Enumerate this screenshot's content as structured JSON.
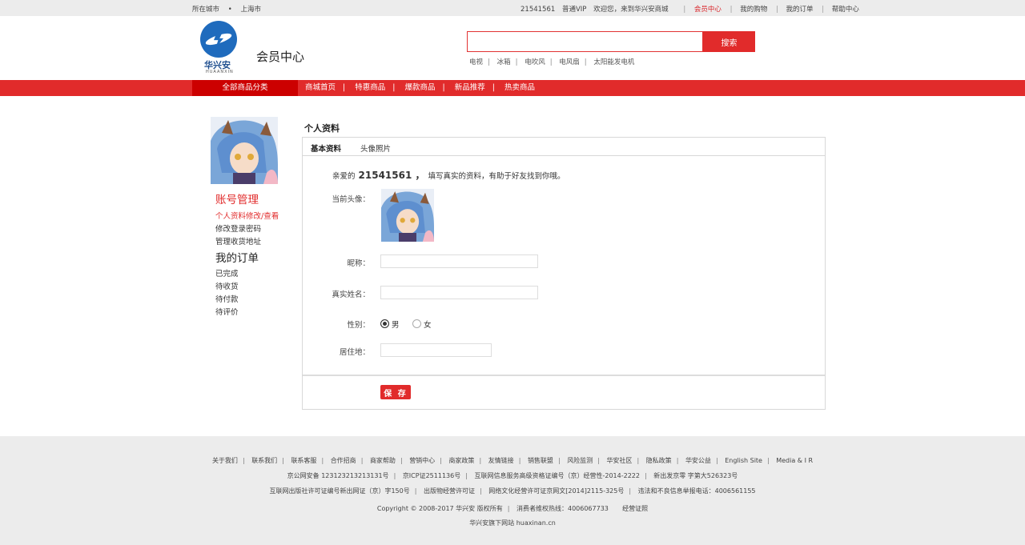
{
  "topbar": {
    "city_label": "所在城市",
    "dot": "•",
    "city": "上海市",
    "user_id": "21541561",
    "vip": "普通VIP",
    "welcome": "欢迎您，来到华兴安商城",
    "links": [
      "会员中心",
      "我的购物",
      "我的订单",
      "帮助中心"
    ]
  },
  "header": {
    "logo_cn": "华兴安",
    "logo_en": "HUAANXIN",
    "page_title": "会员中心",
    "search_placeholder": "",
    "search_button": "搜索",
    "hot_words": [
      "电视",
      "冰箱",
      "电吹风",
      "电风扇",
      "太阳能发电机"
    ]
  },
  "nav": {
    "all_categories": "全部商品分类",
    "items": [
      "商城首页",
      "特惠商品",
      "爆款商品",
      "新品推荐",
      "热卖商品"
    ]
  },
  "sidebar": {
    "account_heading": "账号管理",
    "account_items": [
      "个人资料修改/查看",
      "修改登录密码",
      "管理收货地址"
    ],
    "orders_heading": "我的订单",
    "order_items": [
      "已完成",
      "待收货",
      "待付款",
      "待评价"
    ]
  },
  "main": {
    "title": "个人资料",
    "tabs": [
      "基本资料",
      "头像照片"
    ],
    "greeting_prefix": "亲爱的",
    "greeting_user": "21541561 ，",
    "greeting_suffix": "填写真实的资料，有助于好友找到你哦。",
    "labels": {
      "avatar": "当前头像：",
      "nickname": "昵称：",
      "realname": "真实姓名：",
      "gender": "性别：",
      "residence": "居住地："
    },
    "gender_options": [
      "男",
      "女"
    ],
    "gender_selected": "男",
    "nickname_value": "",
    "realname_value": "",
    "residence_value": "",
    "save_button": "保 存"
  },
  "footer": {
    "links": [
      "关于我们",
      "联系我们",
      "联系客服",
      "合作招商",
      "商家帮助",
      "营销中心",
      "商家政策",
      "友情链接",
      "销售联盟",
      "风险监测",
      "华安社区",
      "隐私政策",
      "华安公益",
      "English  Site",
      "Media & I R"
    ],
    "line2": [
      "京公网安备  12312321321313​1号",
      "京ICP证2511136号",
      "互联网信息服务高级资格证编号（京）经营性-2014-2222",
      "新出发京零  字第大526323号"
    ],
    "line3": [
      "互联网出版社许可证编号新出网证（京）字150号",
      "出版物经营许可证",
      "网络文化经营许可证京网文[2014]2115-325号",
      "违法和不良信息举报电话：4006561155"
    ],
    "line4": [
      "Copyright © 2008-2017   华兴安 版权所有",
      "消费者维权热线：4006067733",
      "经营证照"
    ],
    "line5": "华兴安旗下网站  huaxinan.cn"
  },
  "colors": {
    "accent": "#e12b2b",
    "nav_dark": "#cc0000",
    "logo_blue": "#1f6bbd",
    "footer_bg": "#ececec"
  }
}
